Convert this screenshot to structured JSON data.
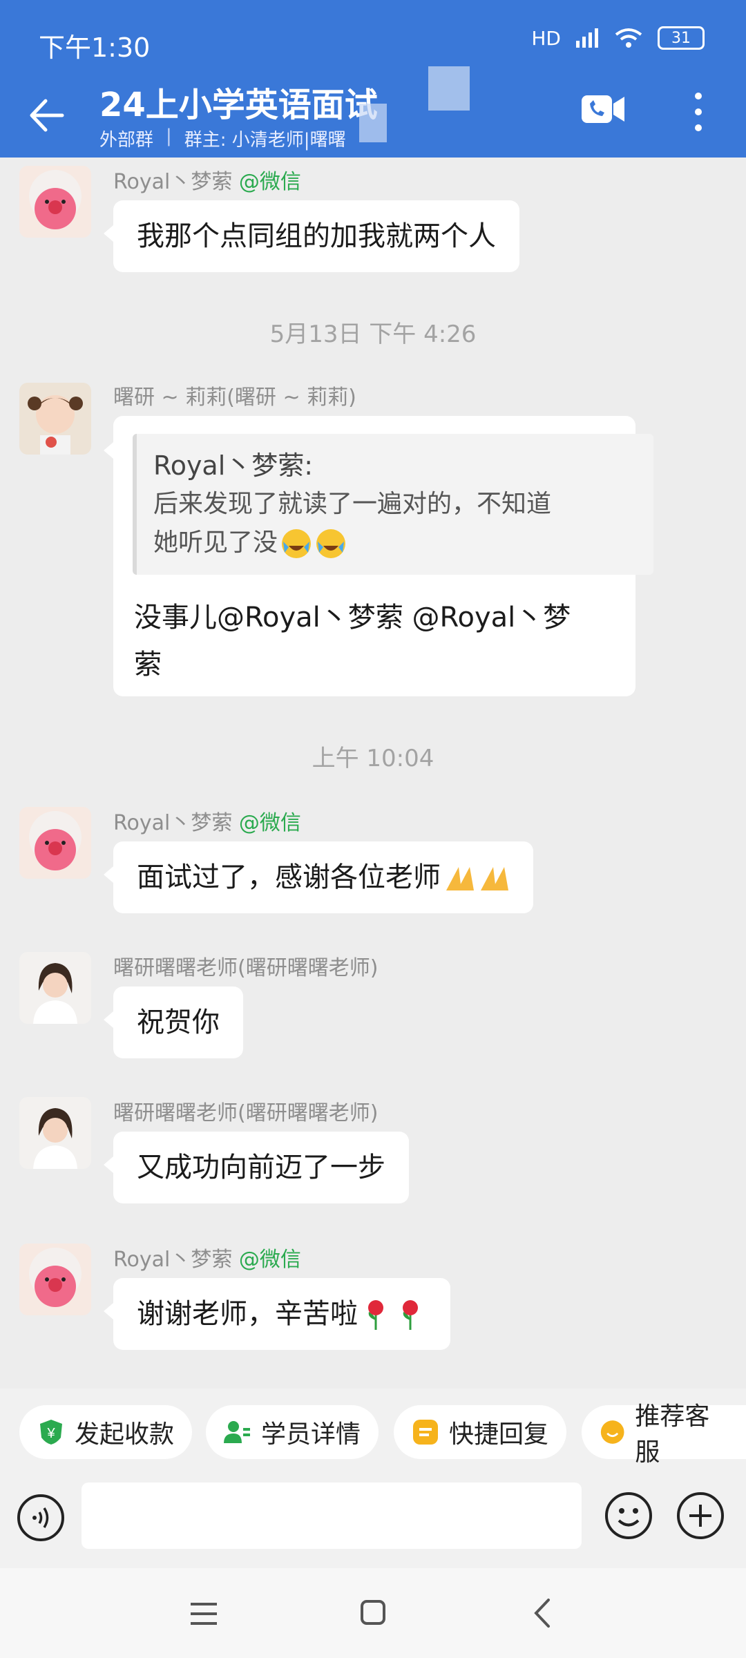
{
  "status_bar": {
    "time": "下午1:30",
    "network": "HD",
    "battery": "31"
  },
  "header": {
    "title": "24上小学英语面试",
    "tag": "外部群",
    "owner": "群主: 小清老师|曙曙"
  },
  "messages": [
    {
      "sender": "Royal丶梦萦",
      "source": "@微信",
      "text": "我那个点同组的加我就两个人"
    },
    {
      "divider": "5月13日 下午 4:26"
    },
    {
      "sender": "曙研 ~ 莉莉(曙研 ~ 莉莉)",
      "quote_name": "Royal丶梦萦:",
      "quote_line1": "后来发现了就读了一遍对的，不知道",
      "quote_line2": "她听见了没",
      "text_line1": "没事儿@Royal丶梦萦 @Royal丶梦",
      "text_line2": "萦"
    },
    {
      "divider": "上午 10:04"
    },
    {
      "sender": "Royal丶梦萦",
      "source": "@微信",
      "text": "面试过了，感谢各位老师"
    },
    {
      "sender": "曙研曙曙老师(曙研曙曙老师)",
      "text": "祝贺你"
    },
    {
      "sender": "曙研曙曙老师(曙研曙曙老师)",
      "text": "又成功向前迈了一步"
    },
    {
      "sender": "Royal丶梦萦",
      "source": "@微信",
      "text": "谢谢老师，辛苦啦"
    }
  ],
  "actions": {
    "collect": "发起收款",
    "student": "学员详情",
    "quick_reply": "快捷回复",
    "recommend": "推荐客服"
  },
  "colors": {
    "header": "#3A78D8",
    "wechat_green": "#2BAA4F",
    "bubble": "#FFFFFF",
    "background": "#EDEDED"
  }
}
